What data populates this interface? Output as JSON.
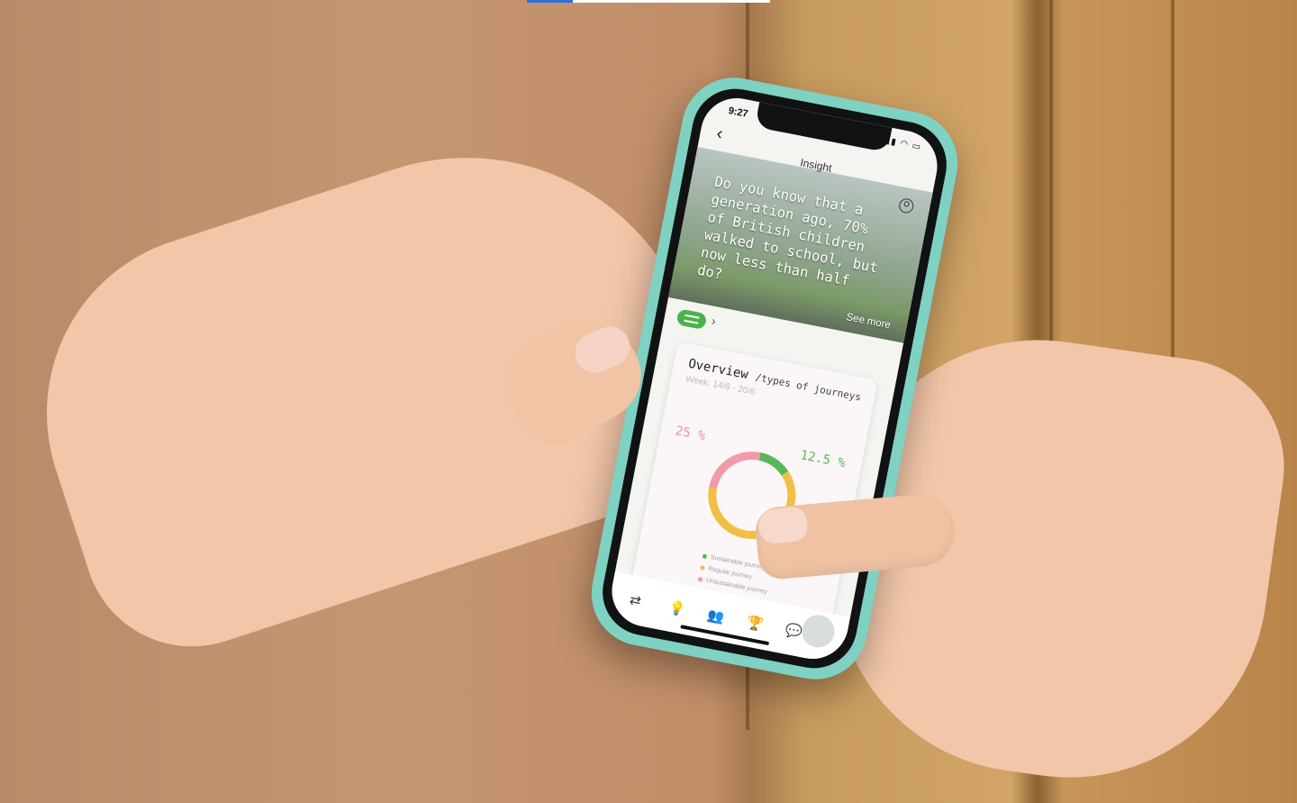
{
  "status_bar": {
    "time": "9:27",
    "icons": "▮▮ ◠ ▭"
  },
  "header": {
    "title": "Insight",
    "back_icon": "chevron-left-icon",
    "profile_icon": "user-circle-icon"
  },
  "hero": {
    "fact": "Do you know that a generation ago, 70% of British children walked to school, but now less than half do?",
    "see_more": "See more"
  },
  "filter": {
    "icon": "sliders-icon",
    "chevron": "›"
  },
  "overview": {
    "title": "Overview",
    "subtitle": "/types of journeys",
    "week": "Week: 14/6 - 20/6",
    "left_pct": "25 %",
    "right_pct": "12.5 %",
    "segments": [
      {
        "label": "Sustainable journey",
        "value": 12.5,
        "color": "#58b75a"
      },
      {
        "label": "Regular journey",
        "value": 62.5,
        "color": "#f0bf45"
      },
      {
        "label": "Unsustainable journey",
        "value": 25,
        "color": "#f29aab"
      }
    ]
  },
  "tabs": [
    {
      "name": "journeys",
      "icon": "⇄"
    },
    {
      "name": "insight",
      "icon": "💡"
    },
    {
      "name": "community",
      "icon": "👥"
    },
    {
      "name": "rewards",
      "icon": "🏆"
    },
    {
      "name": "messages",
      "icon": "💬"
    }
  ],
  "video_progress": 0.19
}
